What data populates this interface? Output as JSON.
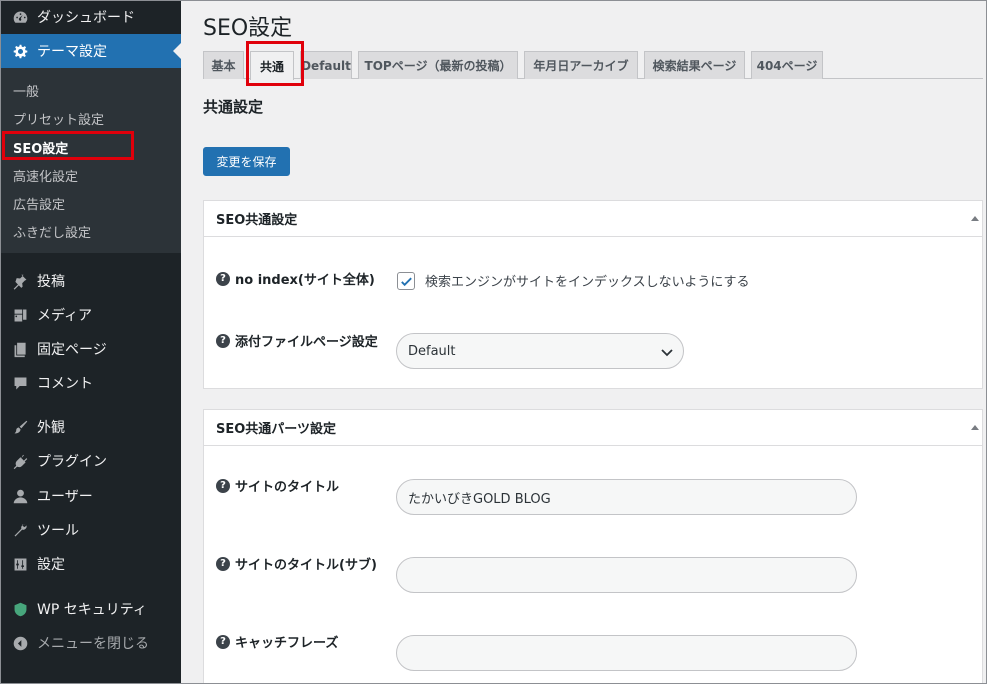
{
  "sidebar": {
    "dashboard": "ダッシュボード",
    "theme_settings": "テーマ設定",
    "submenu": [
      "一般",
      "プリセット設定",
      "SEO設定",
      "高速化設定",
      "広告設定",
      "ふきだし設定"
    ],
    "posts": "投稿",
    "media": "メディア",
    "pages": "固定ページ",
    "comments": "コメント",
    "appearance": "外観",
    "plugins": "プラグイン",
    "users": "ユーザー",
    "tools": "ツール",
    "settings": "設定",
    "wp_security": "WP セキュリティ",
    "collapse": "メニューを閉じる"
  },
  "page": {
    "title": "SEO設定",
    "tabs": [
      "基本",
      "共通",
      "Default",
      "TOPページ（最新の投稿）",
      "年月日アーカイブ",
      "検索結果ページ",
      "404ページ"
    ],
    "active_tab": "共通",
    "section_title": "共通設定",
    "save_label": "変更を保存"
  },
  "panel_common": {
    "title": "SEO共通設定",
    "noindex_label": "no index(サイト全体)",
    "noindex_checked": true,
    "noindex_text": "検索エンジンがサイトをインデックスしないようにする",
    "attachment_label": "添付ファイルページ設定",
    "attachment_value": "Default"
  },
  "panel_parts": {
    "title": "SEO共通パーツ設定",
    "site_title_label": "サイトのタイトル",
    "site_title_value": "たかいびきGOLD BLOG",
    "site_subtitle_label": "サイトのタイトル(サブ)",
    "site_subtitle_value": "",
    "catchphrase_label": "キャッチフレーズ",
    "catchphrase_value": ""
  },
  "colors": {
    "sidebar_bg": "#1d2327",
    "accent": "#2271b1",
    "highlight_box": "#e0000b"
  }
}
